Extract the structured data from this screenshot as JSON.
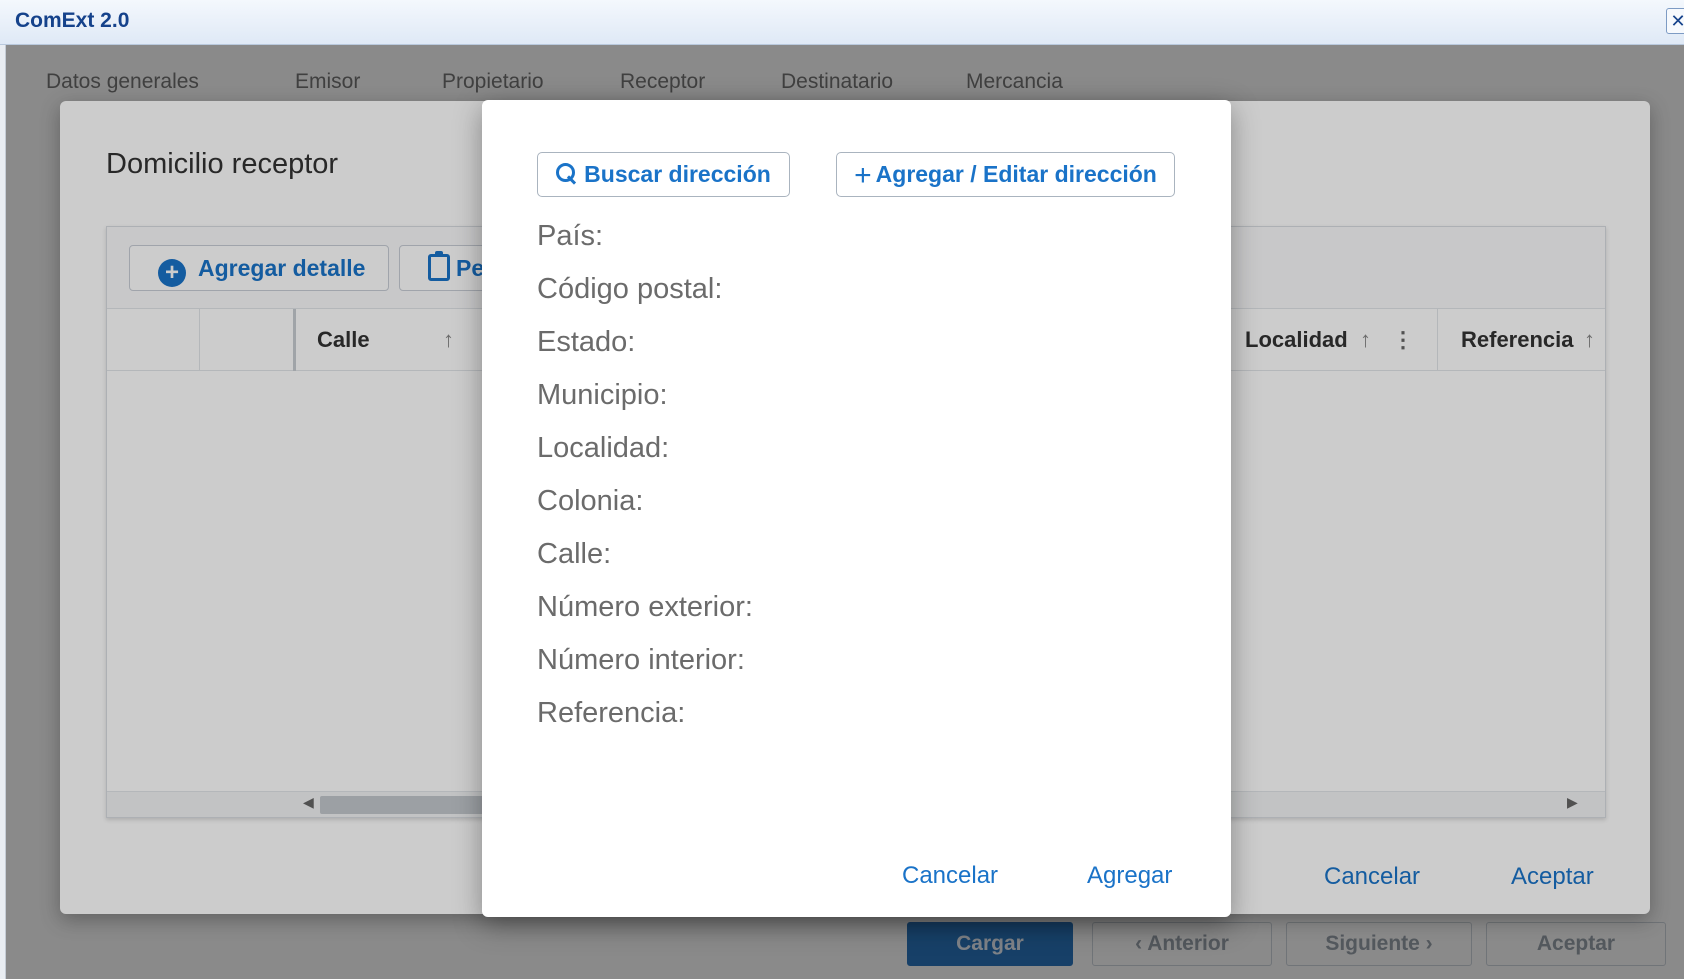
{
  "window": {
    "title": "ComExt 2.0",
    "close_glyph": "✕"
  },
  "wizard_tabs": [
    "Datos generales",
    "Emisor",
    "Propietario",
    "Receptor",
    "Destinatario",
    "Mercancia"
  ],
  "bottom_buttons": {
    "cargar": "Cargar",
    "anterior": "Anterior",
    "siguiente": "Siguiente",
    "aceptar": "Aceptar"
  },
  "domicilio_dialog": {
    "title": "Domicilio receptor",
    "toolbar": {
      "agregar_detalle": "Agregar detalle",
      "second_button_visible": "Pe"
    },
    "columns": [
      "Calle",
      "Localidad",
      "Referencia"
    ],
    "cancel": "Cancelar",
    "accept": "Aceptar"
  },
  "address_dialog": {
    "search_button": "Buscar dirección",
    "edit_button": "Agregar / Editar dirección",
    "fields": [
      "País:",
      "Código postal:",
      "Estado:",
      "Municipio:",
      "Localidad:",
      "Colonia:",
      "Calle:",
      "Número exterior:",
      "Número interior:",
      "Referencia:"
    ],
    "cancel": "Cancelar",
    "add": "Agregar"
  },
  "icons": {
    "search": "search-icon",
    "plus": "plus-icon",
    "add_circle": "plus-circle-icon",
    "clipboard": "clipboard-icon",
    "sort": "arrow-up-icon",
    "menu": "kebab-menu-icon"
  },
  "colors": {
    "accent": "#1a73c8",
    "title": "#15428b"
  }
}
